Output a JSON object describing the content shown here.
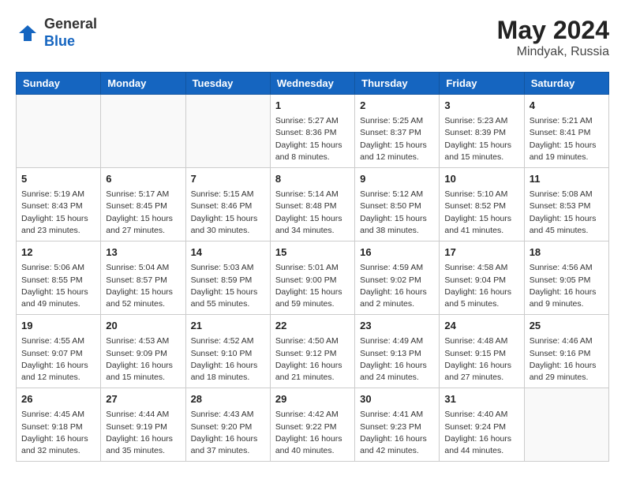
{
  "header": {
    "logo_general": "General",
    "logo_blue": "Blue",
    "month_year": "May 2024",
    "location": "Mindyak, Russia"
  },
  "weekdays": [
    "Sunday",
    "Monday",
    "Tuesday",
    "Wednesday",
    "Thursday",
    "Friday",
    "Saturday"
  ],
  "weeks": [
    [
      {
        "day": "",
        "info": ""
      },
      {
        "day": "",
        "info": ""
      },
      {
        "day": "",
        "info": ""
      },
      {
        "day": "1",
        "info": "Sunrise: 5:27 AM\nSunset: 8:36 PM\nDaylight: 15 hours\nand 8 minutes."
      },
      {
        "day": "2",
        "info": "Sunrise: 5:25 AM\nSunset: 8:37 PM\nDaylight: 15 hours\nand 12 minutes."
      },
      {
        "day": "3",
        "info": "Sunrise: 5:23 AM\nSunset: 8:39 PM\nDaylight: 15 hours\nand 15 minutes."
      },
      {
        "day": "4",
        "info": "Sunrise: 5:21 AM\nSunset: 8:41 PM\nDaylight: 15 hours\nand 19 minutes."
      }
    ],
    [
      {
        "day": "5",
        "info": "Sunrise: 5:19 AM\nSunset: 8:43 PM\nDaylight: 15 hours\nand 23 minutes."
      },
      {
        "day": "6",
        "info": "Sunrise: 5:17 AM\nSunset: 8:45 PM\nDaylight: 15 hours\nand 27 minutes."
      },
      {
        "day": "7",
        "info": "Sunrise: 5:15 AM\nSunset: 8:46 PM\nDaylight: 15 hours\nand 30 minutes."
      },
      {
        "day": "8",
        "info": "Sunrise: 5:14 AM\nSunset: 8:48 PM\nDaylight: 15 hours\nand 34 minutes."
      },
      {
        "day": "9",
        "info": "Sunrise: 5:12 AM\nSunset: 8:50 PM\nDaylight: 15 hours\nand 38 minutes."
      },
      {
        "day": "10",
        "info": "Sunrise: 5:10 AM\nSunset: 8:52 PM\nDaylight: 15 hours\nand 41 minutes."
      },
      {
        "day": "11",
        "info": "Sunrise: 5:08 AM\nSunset: 8:53 PM\nDaylight: 15 hours\nand 45 minutes."
      }
    ],
    [
      {
        "day": "12",
        "info": "Sunrise: 5:06 AM\nSunset: 8:55 PM\nDaylight: 15 hours\nand 49 minutes."
      },
      {
        "day": "13",
        "info": "Sunrise: 5:04 AM\nSunset: 8:57 PM\nDaylight: 15 hours\nand 52 minutes."
      },
      {
        "day": "14",
        "info": "Sunrise: 5:03 AM\nSunset: 8:59 PM\nDaylight: 15 hours\nand 55 minutes."
      },
      {
        "day": "15",
        "info": "Sunrise: 5:01 AM\nSunset: 9:00 PM\nDaylight: 15 hours\nand 59 minutes."
      },
      {
        "day": "16",
        "info": "Sunrise: 4:59 AM\nSunset: 9:02 PM\nDaylight: 16 hours\nand 2 minutes."
      },
      {
        "day": "17",
        "info": "Sunrise: 4:58 AM\nSunset: 9:04 PM\nDaylight: 16 hours\nand 5 minutes."
      },
      {
        "day": "18",
        "info": "Sunrise: 4:56 AM\nSunset: 9:05 PM\nDaylight: 16 hours\nand 9 minutes."
      }
    ],
    [
      {
        "day": "19",
        "info": "Sunrise: 4:55 AM\nSunset: 9:07 PM\nDaylight: 16 hours\nand 12 minutes."
      },
      {
        "day": "20",
        "info": "Sunrise: 4:53 AM\nSunset: 9:09 PM\nDaylight: 16 hours\nand 15 minutes."
      },
      {
        "day": "21",
        "info": "Sunrise: 4:52 AM\nSunset: 9:10 PM\nDaylight: 16 hours\nand 18 minutes."
      },
      {
        "day": "22",
        "info": "Sunrise: 4:50 AM\nSunset: 9:12 PM\nDaylight: 16 hours\nand 21 minutes."
      },
      {
        "day": "23",
        "info": "Sunrise: 4:49 AM\nSunset: 9:13 PM\nDaylight: 16 hours\nand 24 minutes."
      },
      {
        "day": "24",
        "info": "Sunrise: 4:48 AM\nSunset: 9:15 PM\nDaylight: 16 hours\nand 27 minutes."
      },
      {
        "day": "25",
        "info": "Sunrise: 4:46 AM\nSunset: 9:16 PM\nDaylight: 16 hours\nand 29 minutes."
      }
    ],
    [
      {
        "day": "26",
        "info": "Sunrise: 4:45 AM\nSunset: 9:18 PM\nDaylight: 16 hours\nand 32 minutes."
      },
      {
        "day": "27",
        "info": "Sunrise: 4:44 AM\nSunset: 9:19 PM\nDaylight: 16 hours\nand 35 minutes."
      },
      {
        "day": "28",
        "info": "Sunrise: 4:43 AM\nSunset: 9:20 PM\nDaylight: 16 hours\nand 37 minutes."
      },
      {
        "day": "29",
        "info": "Sunrise: 4:42 AM\nSunset: 9:22 PM\nDaylight: 16 hours\nand 40 minutes."
      },
      {
        "day": "30",
        "info": "Sunrise: 4:41 AM\nSunset: 9:23 PM\nDaylight: 16 hours\nand 42 minutes."
      },
      {
        "day": "31",
        "info": "Sunrise: 4:40 AM\nSunset: 9:24 PM\nDaylight: 16 hours\nand 44 minutes."
      },
      {
        "day": "",
        "info": ""
      }
    ]
  ]
}
